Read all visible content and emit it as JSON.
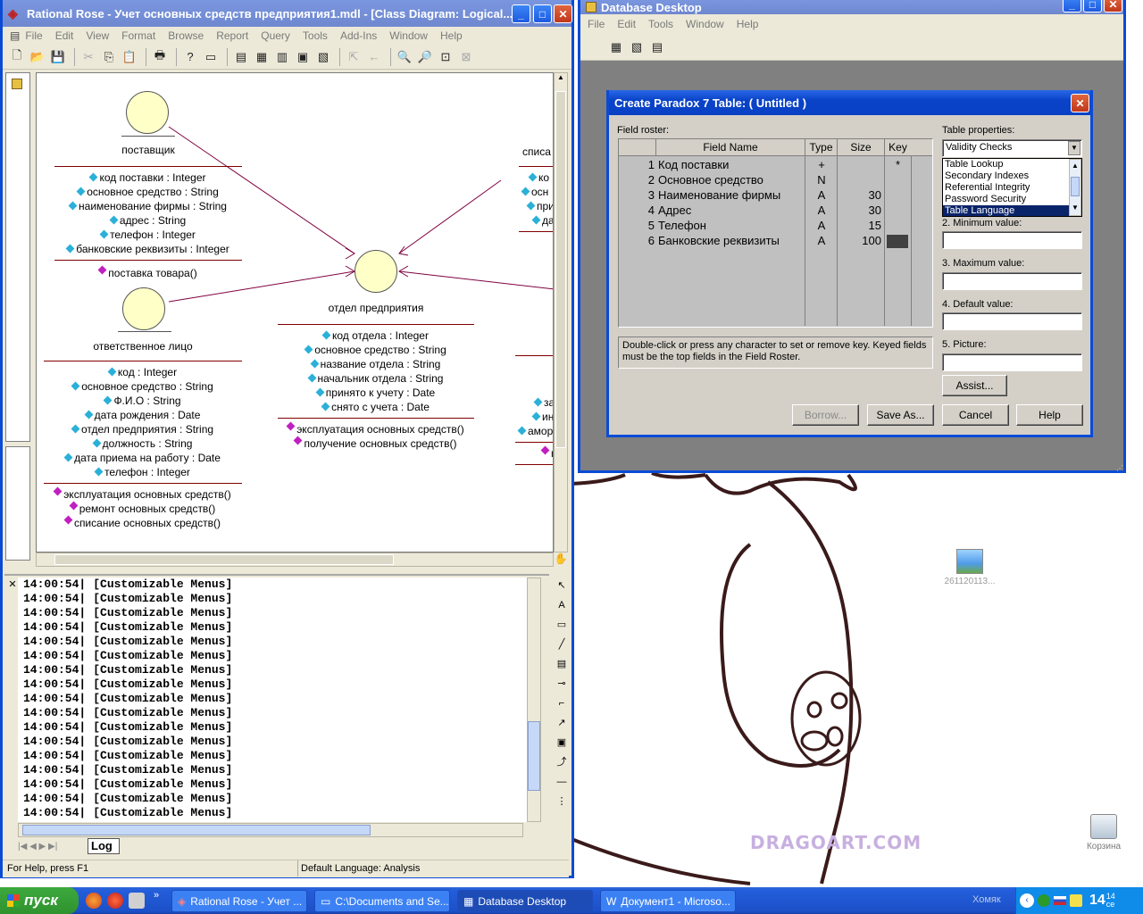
{
  "desktop": {
    "icons": [
      {
        "label": "261120113..."
      },
      {
        "label": "Корзина"
      }
    ],
    "watermark": "DRAGOART.COM"
  },
  "rose": {
    "title": "Rational Rose - Учет основных средств предприятия1.mdl - [Class Diagram: Logical...",
    "menu": [
      "File",
      "Edit",
      "View",
      "Format",
      "Browse",
      "Report",
      "Query",
      "Tools",
      "Add-Ins",
      "Window",
      "Help"
    ],
    "classes": {
      "supplier": {
        "name": "поставщик",
        "attributes": [
          "код поставки : Integer",
          "основное средство : String",
          "наименование фирмы : String",
          "адрес : String",
          "телефон : Integer",
          "банковские реквизиты : Integer"
        ],
        "operations": [
          "поставка товара()"
        ]
      },
      "responsible": {
        "name": "ответственное лицо",
        "attributes": [
          "код : Integer",
          "основное средство : String",
          "Ф.И.О : String",
          "дата рождения : Date",
          "отдел предприятия : String",
          "должность : String",
          "дата приема на работу : Date",
          "телефон : Integer"
        ],
        "operations": [
          "эксплуатация основных средств()",
          "ремонт основных средств()",
          "списание основных средств()"
        ]
      },
      "department": {
        "name": "отдел предприятия",
        "attributes": [
          "код отдела : Integer",
          "основное средство : String",
          "название отдела : String",
          "начальник отдела : String",
          "принято к учету : Date",
          "снято с учета : Date"
        ],
        "operations": [
          "эксплуатация основных средств()",
          "получение основных средств()"
        ]
      },
      "writeoff_partial": {
        "name": "списа",
        "attributes": [
          "ко",
          "осн",
          "при",
          "да"
        ]
      },
      "right_partial": {
        "attributes": [
          "за",
          "ин",
          "амор",
          "п"
        ]
      }
    },
    "log": {
      "lines": [
        {
          "time": "14:00:54|",
          "text": "[Customizable Menus]"
        },
        {
          "time": "14:00:54|",
          "text": "[Customizable Menus]"
        },
        {
          "time": "14:00:54|",
          "text": "[Customizable Menus]"
        },
        {
          "time": "14:00:54|",
          "text": "[Customizable Menus]"
        },
        {
          "time": "14:00:54|",
          "text": "[Customizable Menus]"
        },
        {
          "time": "14:00:54|",
          "text": "[Customizable Menus]"
        },
        {
          "time": "14:00:54|",
          "text": "[Customizable Menus]"
        },
        {
          "time": "14:00:54|",
          "text": "[Customizable Menus]"
        },
        {
          "time": "14:00:54|",
          "text": "[Customizable Menus]"
        },
        {
          "time": "14:00:54|",
          "text": "[Customizable Menus]"
        },
        {
          "time": "14:00:54|",
          "text": "[Customizable Menus]"
        },
        {
          "time": "14:00:54|",
          "text": "[Customizable Menus]"
        },
        {
          "time": "14:00:54|",
          "text": "[Customizable Menus]"
        },
        {
          "time": "14:00:54|",
          "text": "[Customizable Menus]"
        },
        {
          "time": "14:00:54|",
          "text": "[Customizable Menus]"
        },
        {
          "time": "14:00:54|",
          "text": "[Customizable Menus]"
        },
        {
          "time": "14:00:54|",
          "text": "[Customizable Menus]"
        }
      ],
      "tab": "Log"
    },
    "status": {
      "help": "For Help, press F1",
      "language": "Default Language: Analysis"
    }
  },
  "dbdesk": {
    "title": "Database Desktop",
    "menu": [
      "File",
      "Edit",
      "Tools",
      "Window",
      "Help"
    ]
  },
  "dialog": {
    "title": "Create Paradox 7 Table:  ( Untitled )",
    "field_roster_label": "Field roster:",
    "columns": [
      "Field Name",
      "Type",
      "Size",
      "Key"
    ],
    "rows": [
      {
        "num": "1",
        "name": "Код поставки",
        "type": "+",
        "size": "",
        "key": "*"
      },
      {
        "num": "2",
        "name": "Основное средство",
        "type": "N",
        "size": "",
        "key": ""
      },
      {
        "num": "3",
        "name": "Наименование фирмы",
        "type": "A",
        "size": "30",
        "key": ""
      },
      {
        "num": "4",
        "name": "Адрес",
        "type": "A",
        "size": "30",
        "key": ""
      },
      {
        "num": "5",
        "name": "Телефон",
        "type": "A",
        "size": "15",
        "key": ""
      },
      {
        "num": "6",
        "name": "Банковские реквизиты",
        "type": "A",
        "size": "100",
        "key": ""
      }
    ],
    "hint": "Double-click or press any character to set or remove key. Keyed fields must be the top fields in the Field Roster.",
    "table_properties_label": "Table properties:",
    "properties_selected": "Validity Checks",
    "properties_list": [
      "Table Lookup",
      "Secondary Indexes",
      "Referential Integrity",
      "Password Security",
      "Table Language"
    ],
    "selected_list_item": "Table Language",
    "min_label": "2. Minimum value:",
    "max_label": "3. Maximum value:",
    "default_label": "4. Default value:",
    "picture_label": "5. Picture:",
    "buttons": {
      "assist": "Assist...",
      "borrow": "Borrow...",
      "save_as": "Save As...",
      "cancel": "Cancel",
      "help": "Help"
    }
  },
  "taskbar": {
    "start": "пуск",
    "tasks": [
      "Rational Rose - Учет ...",
      "C:\\Documents and Se...",
      "Database Desktop",
      "Документ1 - Microso..."
    ],
    "active_task": "Database Desktop",
    "tray_text": "Хомяк",
    "clock": "14",
    "clock_small": "14",
    "clock_unit": "ce"
  }
}
